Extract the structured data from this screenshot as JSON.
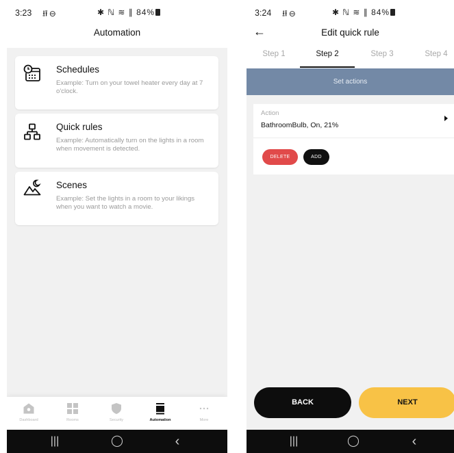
{
  "left": {
    "status": {
      "time": "3:23",
      "icons": "✱ ⊖",
      "right": "✱ ℕ† ≋ ∗∥ 84%"
    },
    "title": "Automation",
    "cards": [
      {
        "title": "Schedules",
        "description": "Example: Turn on your towel heater every day at 7 o'clock.",
        "icon": "schedule-calendar-icon"
      },
      {
        "title": "Quick rules",
        "description": "Example: Automatically turn on the lights in a room when movement is detected.",
        "icon": "flow-diagram-icon"
      },
      {
        "title": "Scenes",
        "description": "Example: Set the lights in a room to your likings when you want to watch a movie.",
        "icon": "moon-mountain-icon"
      }
    ],
    "nav": [
      {
        "label": "Dashboard",
        "icon": "home-icon"
      },
      {
        "label": "Rooms",
        "icon": "grid-icon"
      },
      {
        "label": "Security",
        "icon": "shield-icon"
      },
      {
        "label": "Automation",
        "icon": "automation-icon"
      },
      {
        "label": "More",
        "icon": "more-dots-icon"
      }
    ],
    "nav_active": "Automation",
    "sys": {
      "recent": "|||",
      "home": "◯",
      "back": "‹"
    }
  },
  "right": {
    "status": {
      "time": "3:24",
      "icons": "✱ ⊖",
      "right": "✱ ℕ† ≋ ∗∥ 84%"
    },
    "back_arrow": "←",
    "title": "Edit quick rule",
    "tabs": [
      "Step 1",
      "Step 2",
      "Step 3",
      "Step 4"
    ],
    "active_tab": "Step 2",
    "banner": "Set actions",
    "action": {
      "label": "Action",
      "value": "BathroomBulb, On, 21%"
    },
    "buttons": {
      "delete": "DELETE",
      "add": "ADD",
      "back": "BACK",
      "next": "NEXT"
    },
    "sys": {
      "recent": "|||",
      "home": "◯",
      "back": "‹"
    }
  },
  "colors": {
    "banner": "#7389a6",
    "delete": "#e14a4a",
    "next": "#f8c246",
    "dark": "#0d0d0d",
    "background": "#f1f1f1"
  }
}
